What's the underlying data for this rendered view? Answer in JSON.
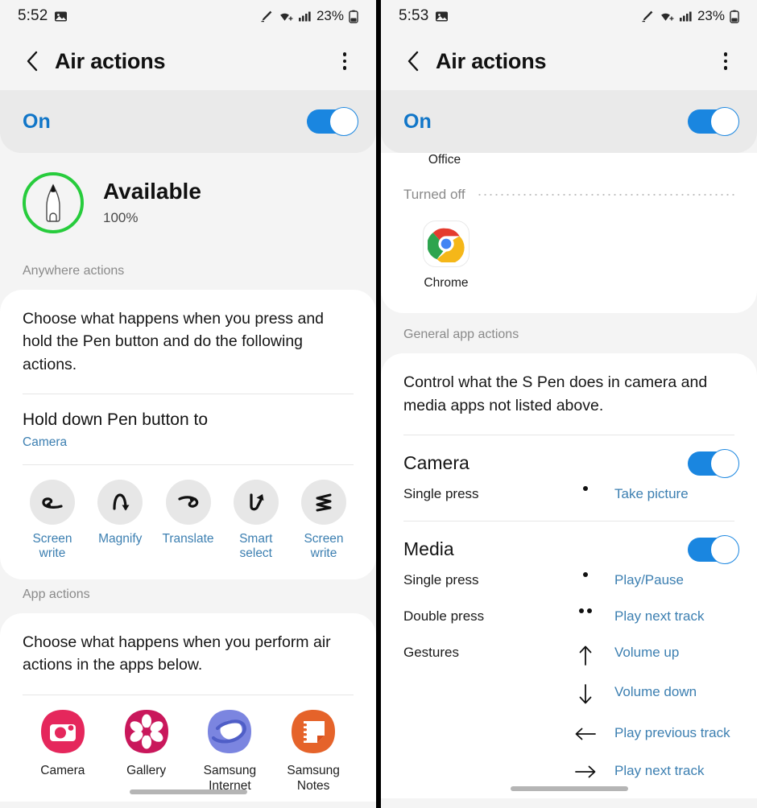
{
  "left": {
    "statusbar": {
      "time": "5:52",
      "battery_pct": "23%",
      "icons": [
        "photo-icon",
        "spen-icon",
        "wifi-plus-icon",
        "signal-icon",
        "battery-icon"
      ]
    },
    "header": {
      "title": "Air actions",
      "back": "back-icon",
      "menu": "more-options-icon"
    },
    "master_toggle": {
      "label": "On",
      "state": "on"
    },
    "pen_status": {
      "state": "Available",
      "battery": "100%",
      "ring_color": "#27cc3c"
    },
    "anywhere_actions": {
      "section_label": "Anywhere actions",
      "description": "Choose what happens when you press and hold the Pen button and do the following actions.",
      "hold_title": "Hold down Pen button to",
      "hold_value": "Camera",
      "gestures": [
        {
          "icon": "gesture-left-arrow-icon",
          "label": "Screen write"
        },
        {
          "icon": "gesture-up-down-icon",
          "label": "Magnify"
        },
        {
          "icon": "gesture-right-arrow-icon",
          "label": "Translate"
        },
        {
          "icon": "gesture-v-up-icon",
          "label": "Smart select"
        },
        {
          "icon": "gesture-zigzag-icon",
          "label": "Screen write"
        }
      ]
    },
    "app_actions": {
      "section_label": "App actions",
      "description": "Choose what happens when you perform air actions in the apps below.",
      "apps": [
        {
          "icon": "camera-app-icon",
          "label": "Camera",
          "color": "#e5275c"
        },
        {
          "icon": "gallery-app-icon",
          "label": "Gallery",
          "color": "#c9175b"
        },
        {
          "icon": "samsung-internet-app-icon",
          "label": "Samsung Internet",
          "color": "#7b85e0"
        },
        {
          "icon": "samsung-notes-app-icon",
          "label": "Samsung Notes",
          "color": "#e5632a"
        }
      ]
    }
  },
  "right": {
    "statusbar": {
      "time": "5:53",
      "battery_pct": "23%"
    },
    "header": {
      "title": "Air actions"
    },
    "master_toggle": {
      "label": "On",
      "state": "on"
    },
    "partial_app_label": "Office",
    "turned_off": {
      "label": "Turned off",
      "apps": [
        {
          "icon": "chrome-app-icon",
          "label": "Chrome"
        }
      ]
    },
    "general_app_actions": {
      "section_label": "General app actions",
      "description": "Control what the S Pen does in camera and media apps not listed above.",
      "groups": [
        {
          "title": "Camera",
          "toggle": "on",
          "rows": [
            {
              "name": "Single press",
              "glyph": "one-dot",
              "value": "Take picture"
            }
          ]
        },
        {
          "title": "Media",
          "toggle": "on",
          "rows": [
            {
              "name": "Single press",
              "glyph": "one-dot",
              "value": "Play/Pause"
            },
            {
              "name": "Double press",
              "glyph": "two-dots",
              "value": "Play next track"
            },
            {
              "name": "Gestures",
              "glyph": "arrow-up",
              "value": "Volume up"
            },
            {
              "name": "",
              "glyph": "arrow-down",
              "value": "Volume down"
            },
            {
              "name": "",
              "glyph": "arrow-left",
              "value": "Play previous track"
            },
            {
              "name": "",
              "glyph": "arrow-right",
              "value": "Play next track"
            }
          ]
        }
      ]
    }
  },
  "theme": {
    "accent_blue": "#1a86e0",
    "link_blue": "#3c7fb1",
    "page_bg": "#f4f4f4",
    "card_bg": "#ffffff"
  }
}
